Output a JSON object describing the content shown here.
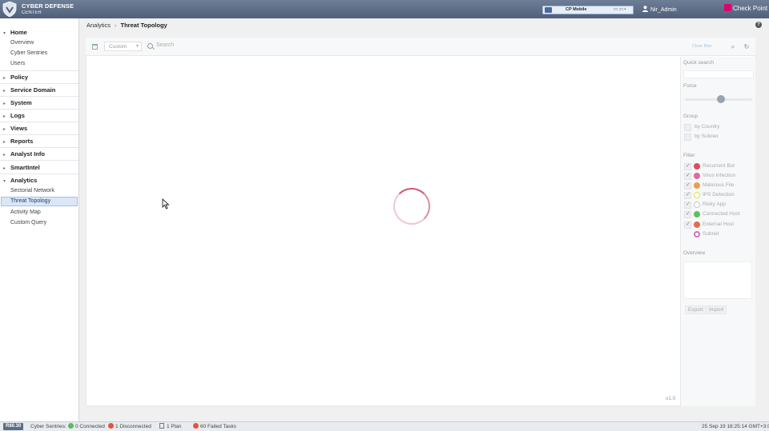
{
  "header": {
    "brand_line1": "CYBER DEFENSE",
    "brand_line2": "CENTER",
    "environment": "CP Mobile",
    "user": "Nir_Admin",
    "vendor": "Check Point",
    "accent": "#5b6b85"
  },
  "sidebar": {
    "home": "Home",
    "home_items": [
      "Overview",
      "Cyber Sentries",
      "Users"
    ],
    "sections": [
      "Policy",
      "Service Domain",
      "System",
      "Logs",
      "Views",
      "Reports",
      "Analyst Info",
      "SmartIntel"
    ],
    "analytics": "Analytics",
    "analytics_items": [
      "Sectorial Network",
      "Threat Topology",
      "Activity Map",
      "Custom Query"
    ],
    "active_item": "Threat Topology"
  },
  "breadcrumb": {
    "parent": "Analytics",
    "current": "Threat Topology"
  },
  "toolbar": {
    "range_select": "Custom",
    "search_placeholder": "Search",
    "clear_filter": "Clear filter"
  },
  "main": {
    "version": "v1.0",
    "loading": true
  },
  "right_panel": {
    "quick_search_label": "Quick search",
    "force_label": "Force",
    "force_value": 0.48,
    "group_label": "Group",
    "group_options": [
      {
        "label": "by Country",
        "checked": false
      },
      {
        "label": "by Subnet",
        "checked": false
      }
    ],
    "filter_label": "Filter",
    "filters": [
      {
        "label": "Recurrent Bot",
        "checked": true,
        "color": "#e04a5f"
      },
      {
        "label": "Virus Infection",
        "checked": true,
        "color": "#e06a9a"
      },
      {
        "label": "Malicious File",
        "checked": true,
        "color": "#e8a04a"
      },
      {
        "label": "IPS Detection",
        "checked": true,
        "color": "#e4e04a"
      },
      {
        "label": "Risky App",
        "checked": true,
        "color": "#c8c8c8"
      },
      {
        "label": "Connected Host",
        "checked": true,
        "color": "#5cc05c"
      },
      {
        "label": "External Host",
        "checked": true,
        "color": "#e86a4a"
      },
      {
        "label": "Subnet",
        "checked": false,
        "color": "#d070c0"
      }
    ],
    "overview_label": "Overview",
    "export_label": "Export",
    "import_label": "Import"
  },
  "status_bar": {
    "version_badge": "R80.30",
    "sentries_label": "Cyber Sentries:",
    "connected": "0 Connected",
    "disconnected": "1 Disconnected",
    "plan": "1 Plan",
    "failed_tasks": "60 Failed Tasks",
    "timestamp": "25 Sep 19 18:25:14 GMT+3:00"
  }
}
